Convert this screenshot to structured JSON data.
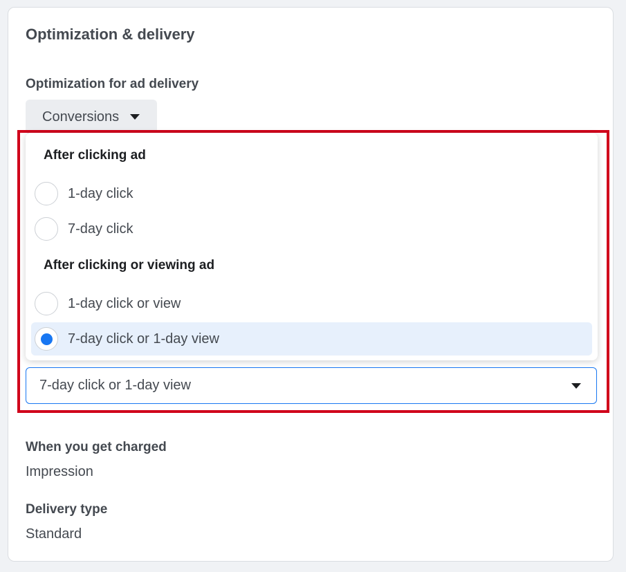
{
  "section": {
    "title": "Optimization & delivery"
  },
  "optimization": {
    "label": "Optimization for ad delivery",
    "value": "Conversions",
    "caret_icon": "caret-down-icon"
  },
  "attribution_menu": {
    "groups": [
      {
        "heading": "After clicking ad",
        "options": [
          {
            "label": "1-day click",
            "selected": false
          },
          {
            "label": "7-day click",
            "selected": false
          }
        ]
      },
      {
        "heading": "After clicking or viewing ad",
        "options": [
          {
            "label": "1-day click or view",
            "selected": false
          },
          {
            "label": "7-day click or 1-day view",
            "selected": true
          }
        ]
      }
    ],
    "radio_selected_color": "#1877f2",
    "selected_row_color": "#e7f0fc"
  },
  "attribution_select": {
    "value": "7-day click or 1-day view"
  },
  "highlight_color": "#d0021b",
  "charging": {
    "label": "When you get charged",
    "value": "Impression"
  },
  "delivery": {
    "label": "Delivery type",
    "value": "Standard"
  }
}
